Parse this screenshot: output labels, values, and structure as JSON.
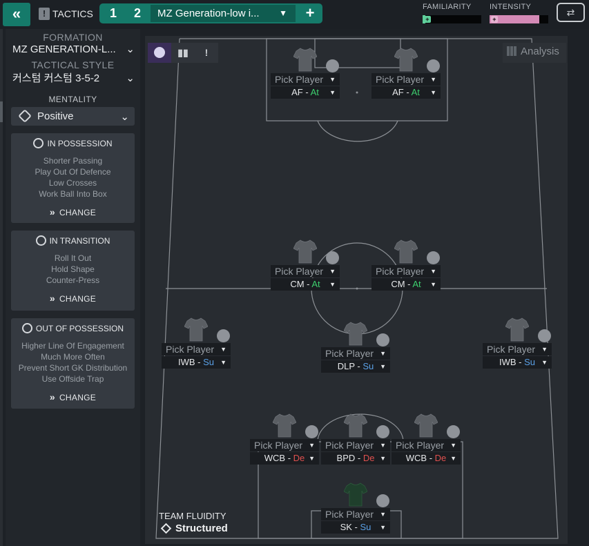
{
  "header": {
    "back_icon": "«",
    "tactics_label": "TACTICS",
    "tab1": "1",
    "tab2": "2",
    "tactic_name": "MZ Generation-low i...",
    "add_label": "+",
    "familiarity_label": "FAMILIARITY",
    "familiarity_level": 0.05,
    "intensity_label": "INTENSITY",
    "intensity_level": 0.85,
    "colors": {
      "accent": "#157a6a",
      "familiarity": "#5fcf9b",
      "intensity": "#d48ab6"
    }
  },
  "sidebar": {
    "formation_label": "FORMATION",
    "formation_value": "MZ GENERATION-L...",
    "style_label": "TACTICAL STYLE",
    "style_value": "커스텀 커스텀 3-5-2",
    "mentality_label": "MENTALITY",
    "mentality_value": "Positive",
    "in_possession": {
      "title": "IN POSSESSION",
      "items": [
        "Shorter Passing",
        "Play Out Of Defence",
        "Low Crosses",
        "Work Ball Into Box"
      ],
      "change": "CHANGE"
    },
    "in_transition": {
      "title": "IN TRANSITION",
      "items": [
        "Roll It Out",
        "Hold Shape",
        "Counter-Press"
      ],
      "change": "CHANGE"
    },
    "out_of_possession": {
      "title": "OUT OF POSSESSION",
      "items": [
        "Higher Line Of Engagement",
        "Much More Often",
        "Prevent Short GK Distribution",
        "Use Offside Trap"
      ],
      "change": "CHANGE"
    }
  },
  "pitch": {
    "analysis_label": "Analysis",
    "fluidity_label": "TEAM FLUIDITY",
    "fluidity_value": "Structured",
    "pick_label": "Pick Player",
    "slots": [
      {
        "role": "AF",
        "duty": "At"
      },
      {
        "role": "AF",
        "duty": "At"
      },
      {
        "role": "CM",
        "duty": "At"
      },
      {
        "role": "CM",
        "duty": "At"
      },
      {
        "role": "IWB",
        "duty": "Su"
      },
      {
        "role": "DLP",
        "duty": "Su"
      },
      {
        "role": "IWB",
        "duty": "Su"
      },
      {
        "role": "WCB",
        "duty": "De"
      },
      {
        "role": "BPD",
        "duty": "De"
      },
      {
        "role": "WCB",
        "duty": "De"
      },
      {
        "role": "SK",
        "duty": "Su"
      }
    ]
  }
}
